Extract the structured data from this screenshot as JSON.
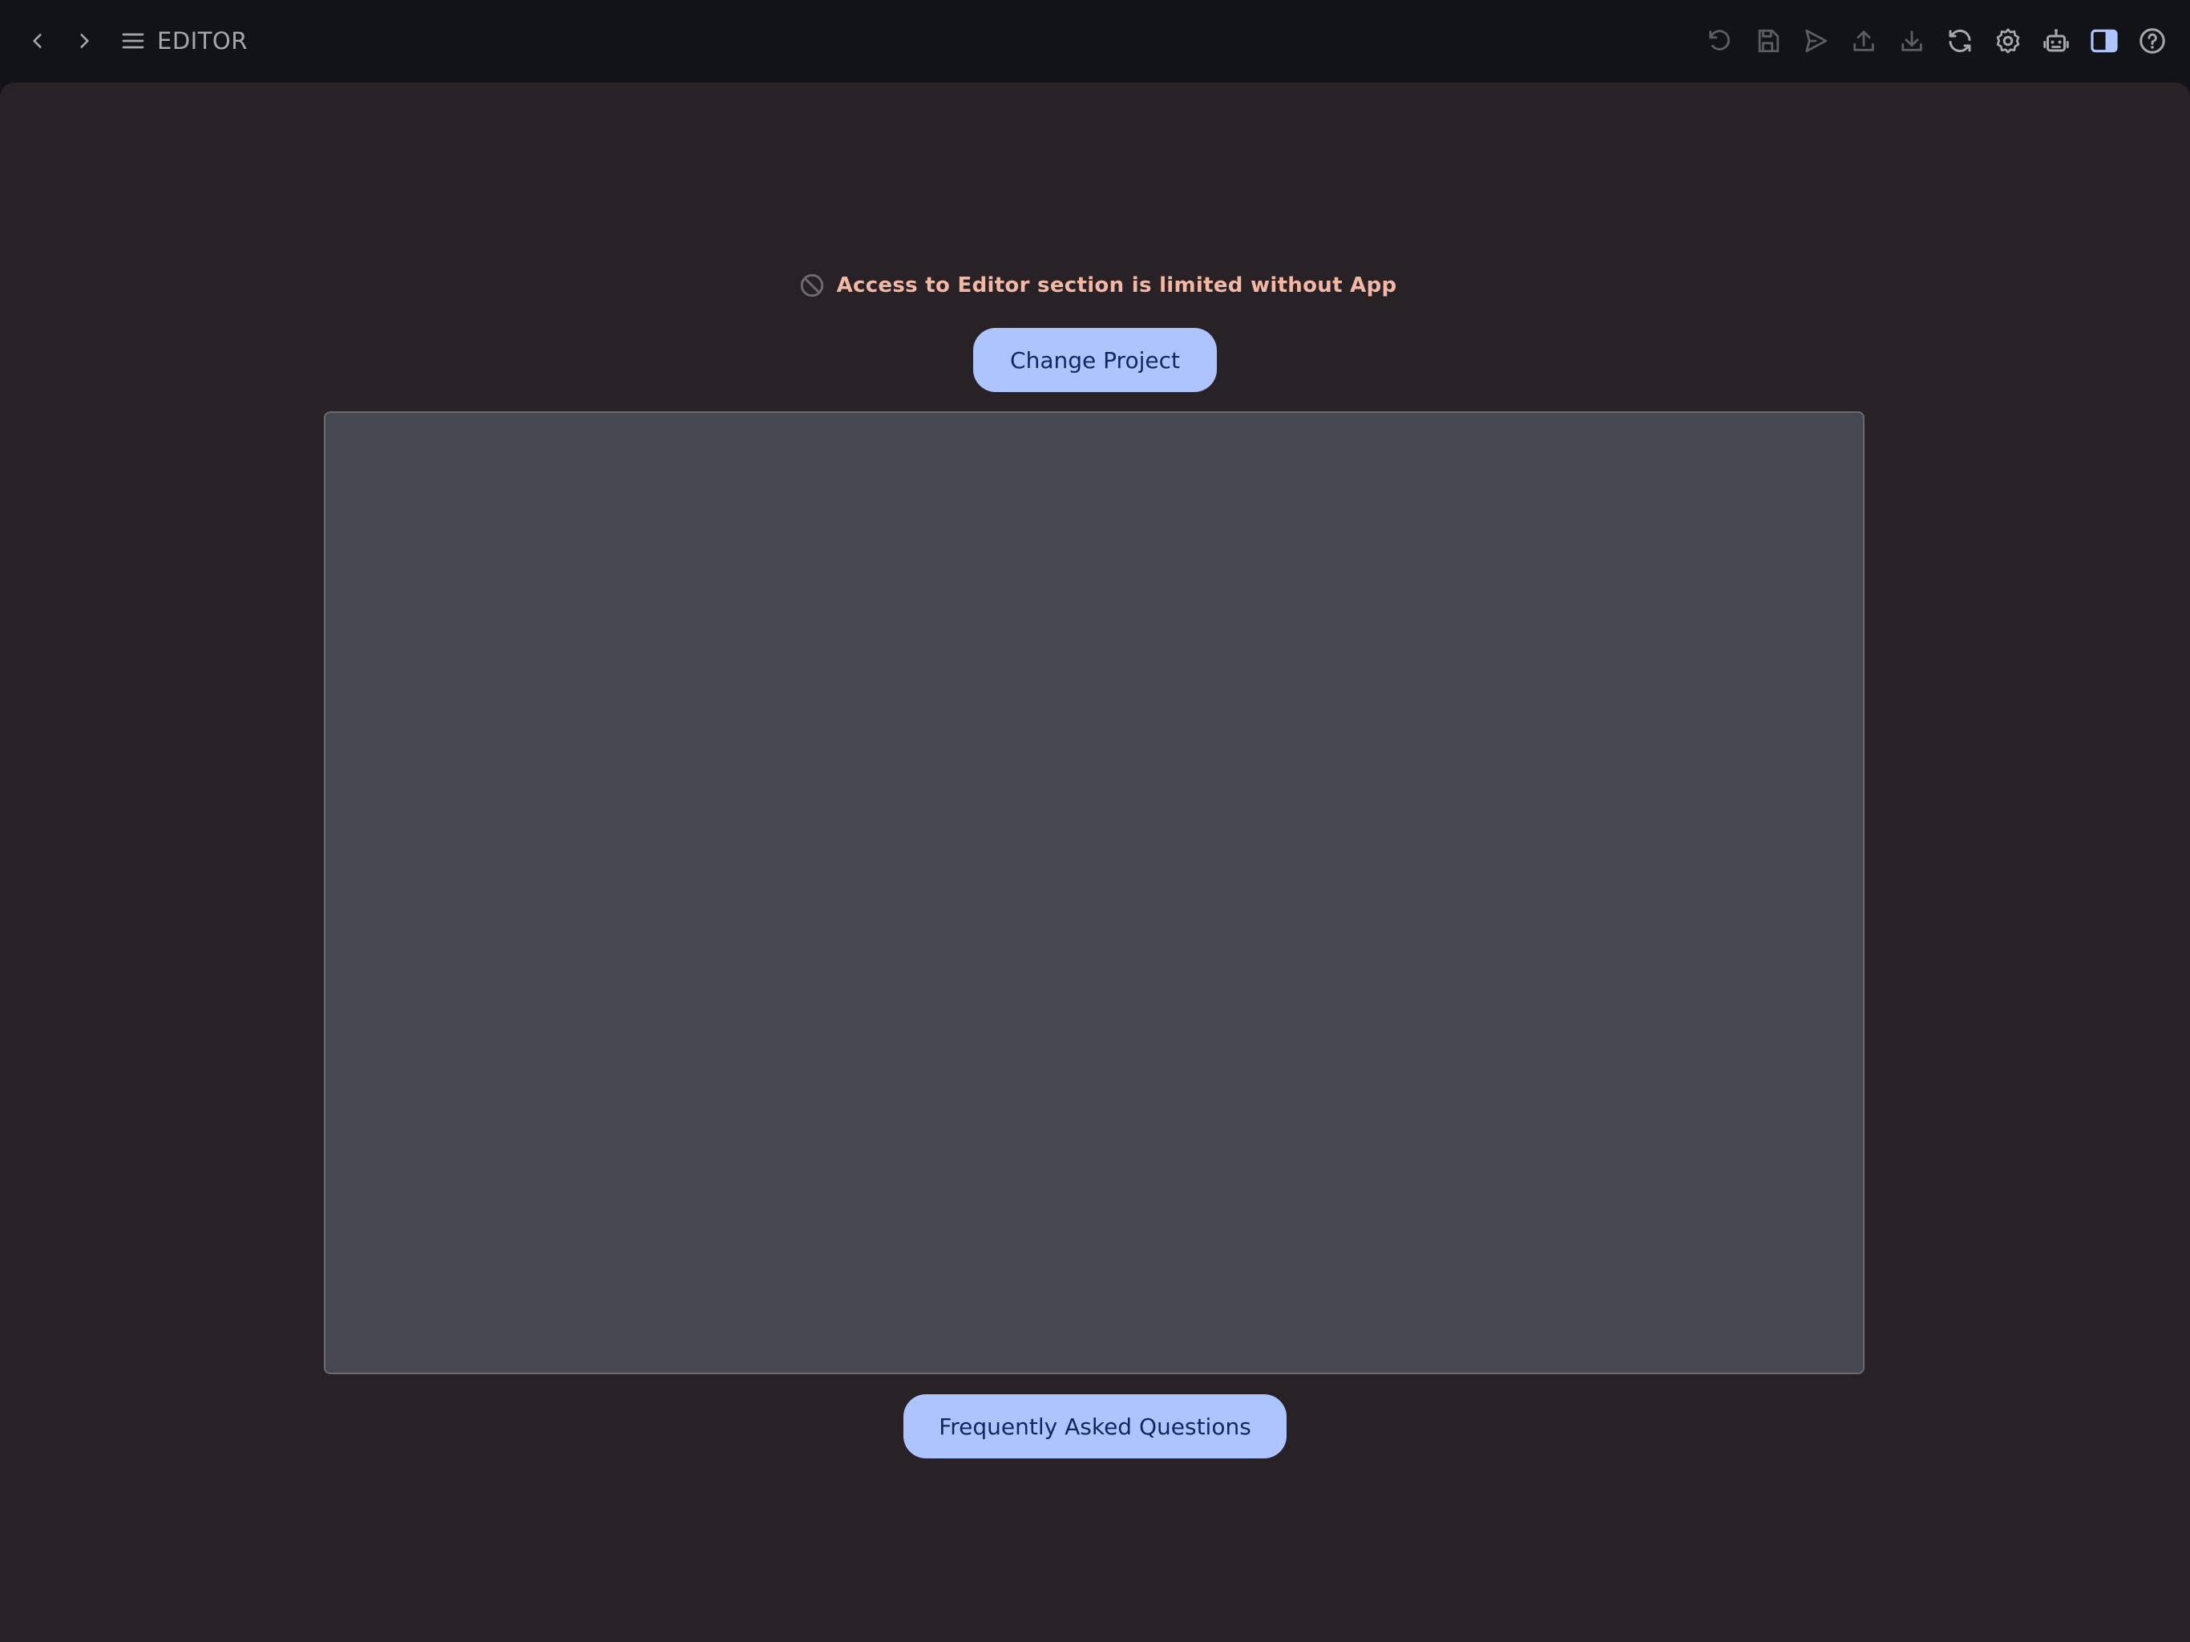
{
  "topbar": {
    "back_icon": "chevron-left-icon",
    "forward_icon": "chevron-right-icon",
    "menu_icon": "hamburger-menu-icon",
    "title": "EDITOR",
    "toolbar_icons": [
      "undo-icon",
      "save-icon",
      "send-icon",
      "upload-icon",
      "download-icon",
      "refresh-icon",
      "settings-gear-icon",
      "robot-icon",
      "panel-toggle-icon",
      "help-icon"
    ],
    "accent": "#aec4fe"
  },
  "main": {
    "notice": {
      "icon": "blocked-icon",
      "text": "Access to Editor section is limited without App",
      "color": "#f3b7a5"
    },
    "change_project_label": "Change Project",
    "faq_label": "Frequently Asked Questions"
  }
}
